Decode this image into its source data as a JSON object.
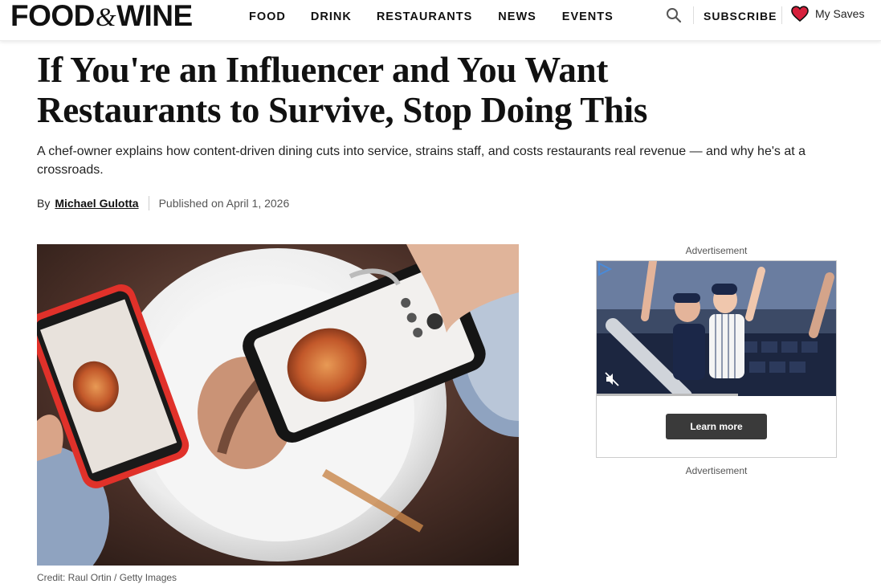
{
  "header": {
    "logo_left": "FOOD",
    "logo_amp": "&",
    "logo_right": "WINE",
    "nav": [
      "FOOD",
      "DRINK",
      "RESTAURANTS",
      "NEWS",
      "EVENTS"
    ],
    "subscribe_label": "SUBSCRIBE",
    "saves_label": "My Saves",
    "search_icon": "search-icon",
    "saves_icon": "heart-icon",
    "heart_color": "#d6203c"
  },
  "article": {
    "headline": "If You're an Influencer and You Want Restaurants to Survive, Stop Doing This",
    "dek": "A chef-owner explains how content-driven dining cuts into service, strains staff, and costs restaurants real revenue — and why he's at a crossroads.",
    "by_label": "By",
    "author": "Michael Gulotta",
    "published": "Published on April 1, 2026",
    "image_credit": "Credit: Raul Ortin / Getty Images"
  },
  "ad": {
    "label_top": "Advertisement",
    "label_bottom": "Advertisement",
    "cta": "Learn more",
    "progress": 0.59,
    "mute_icon": "muted-speaker-icon",
    "play_icon": "play-triangle-icon"
  }
}
